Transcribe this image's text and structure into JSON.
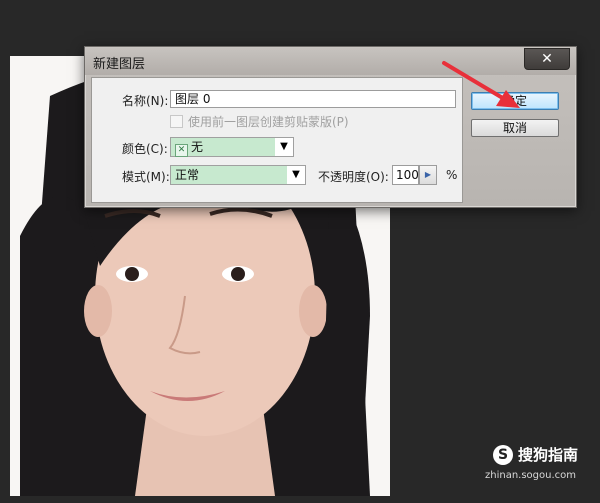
{
  "dialog": {
    "title": "新建图层",
    "close_glyph": "✕",
    "name_label": "名称(N):",
    "name_value": "图层 0",
    "clip_mask_label": "使用前一图层创建剪贴蒙版(P)",
    "color_label": "颜色(C):",
    "color_value": "无",
    "color_swatch_glyph": "✕",
    "mode_label": "模式(M):",
    "mode_value": "正常",
    "opacity_label": "不透明度(O):",
    "opacity_value": "100",
    "opacity_unit": "%",
    "ok_label": "确定",
    "cancel_label": "取消"
  },
  "icons": {
    "dropdown": "chevron-down-icon",
    "close": "close-icon",
    "spinner": "spinner-right-icon"
  },
  "watermark": {
    "logo": "S",
    "name": "搜狗指南",
    "url": "zhinan.sogou.com"
  },
  "colors": {
    "canvas_bg": "#282828",
    "field_highlight": "#c7e9cf",
    "annotation_arrow": "#e8303a",
    "dialog_bg": "#bcb8b4"
  }
}
